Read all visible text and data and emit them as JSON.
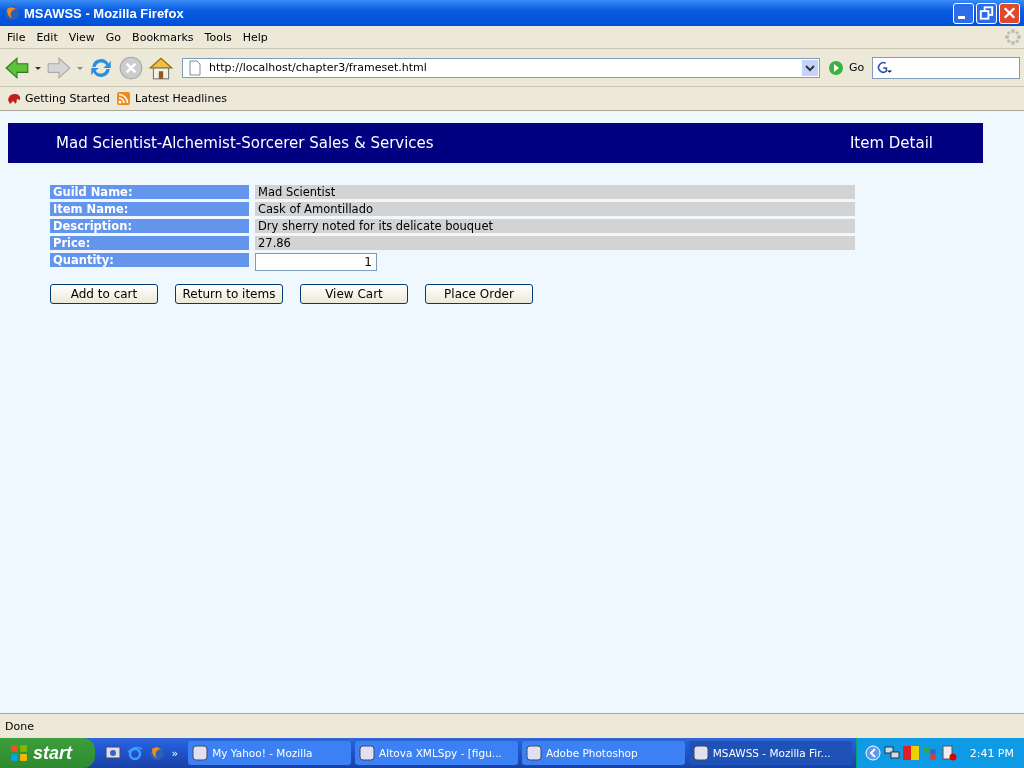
{
  "window": {
    "title": "MSAWSS - Mozilla Firefox"
  },
  "menu": [
    "File",
    "Edit",
    "View",
    "Go",
    "Bookmarks",
    "Tools",
    "Help"
  ],
  "address": {
    "value": "http://localhost/chapter3/frameset.html"
  },
  "go_button": "Go",
  "bookmarks": [
    "Getting Started",
    "Latest Headlines"
  ],
  "page": {
    "banner_title": "Mad Scientist-Alchemist-Sorcerer Sales & Services",
    "banner_section": "Item Detail",
    "fields": [
      {
        "label": "Guild Name:",
        "kind": "text",
        "value": "Mad Scientist"
      },
      {
        "label": "Item Name:",
        "kind": "text",
        "value": "Cask of Amontillado"
      },
      {
        "label": "Description:",
        "kind": "text",
        "value": "Dry sherry noted for its delicate bouquet"
      },
      {
        "label": "Price:",
        "kind": "text",
        "value": "27.86"
      },
      {
        "label": "Quantity:",
        "kind": "input",
        "value": "1"
      }
    ],
    "buttons": [
      "Add to cart",
      "Return to items",
      "View Cart",
      "Place Order"
    ]
  },
  "status_bar": "Done",
  "taskbar": {
    "start": "start",
    "chevron": "»",
    "tasks": [
      {
        "label": "My Yahoo! - Mozilla",
        "selected": false
      },
      {
        "label": "Altova XMLSpy - [figu...",
        "selected": false
      },
      {
        "label": "Adobe Photoshop",
        "selected": false
      },
      {
        "label": "MSAWSS - Mozilla Fir...",
        "selected": true
      }
    ],
    "clock": "2:41 PM"
  }
}
